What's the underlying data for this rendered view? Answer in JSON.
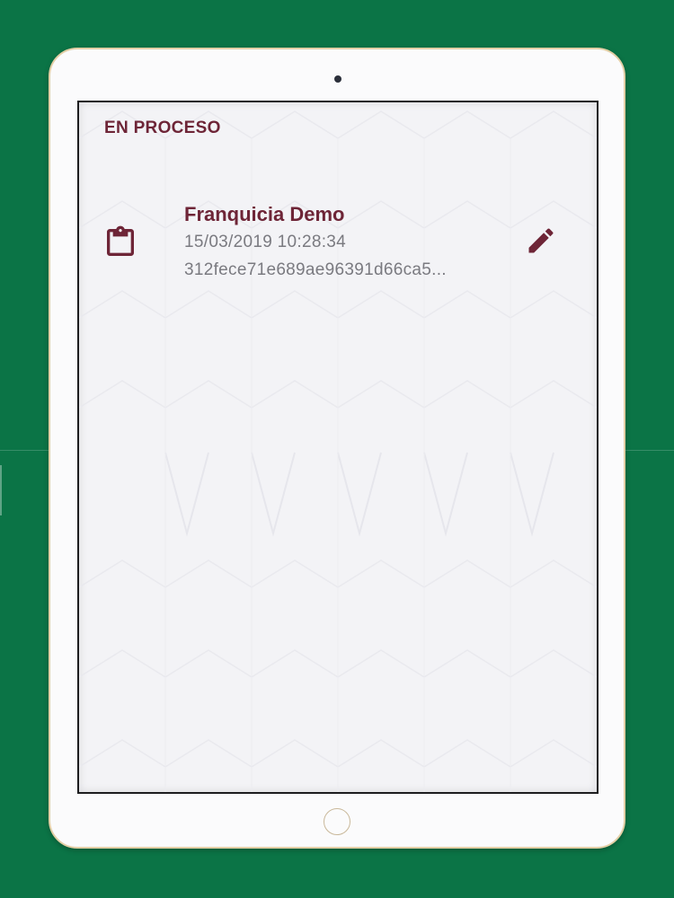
{
  "section": {
    "title": "EN PROCESO"
  },
  "items": [
    {
      "title": "Franquicia Demo",
      "date": "15/03/2019 10:28:34",
      "id": "312fece71e689ae96391d66ca5...",
      "icon": "clipboard-icon",
      "action_icon": "edit-pencil-icon"
    }
  ],
  "colors": {
    "background": "#0b7446",
    "accent": "#6e2537",
    "secondary_text": "#7a7a80",
    "screen": "#f3f3f6"
  }
}
